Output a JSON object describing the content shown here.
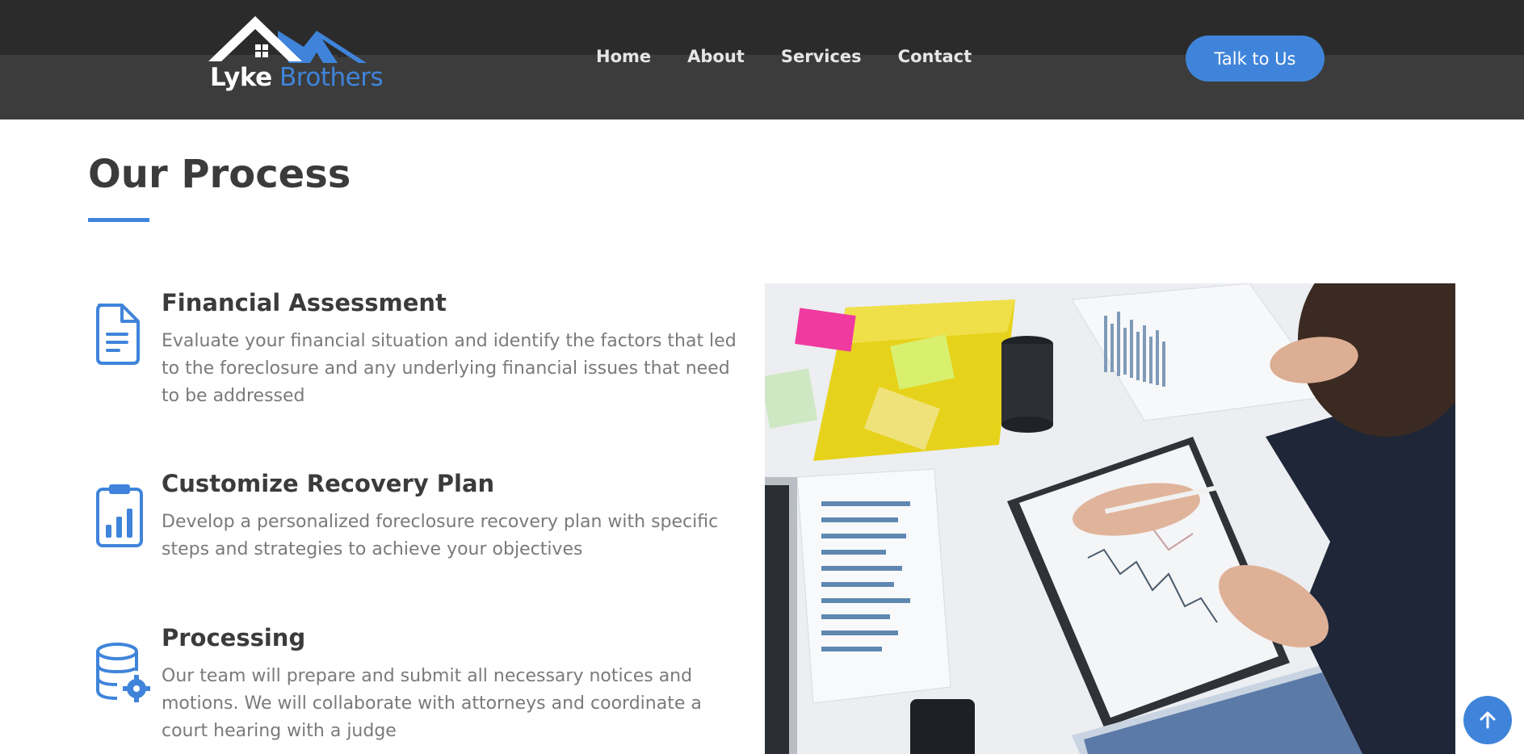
{
  "brand": {
    "name_primary": "Lyke",
    "name_secondary": "Brothers",
    "logo_icon": "house-roof-logo-icon"
  },
  "nav": {
    "items": [
      {
        "label": "Home"
      },
      {
        "label": "About"
      },
      {
        "label": "Services"
      },
      {
        "label": "Contact"
      }
    ],
    "cta_label": "Talk to Us"
  },
  "section": {
    "title": "Our Process",
    "steps": [
      {
        "icon": "document-icon",
        "title": "Financial Assessment",
        "description": "Evaluate your financial situation and identify the factors that led to the foreclosure and any underlying financial issues that need to be addressed"
      },
      {
        "icon": "clipboard-chart-icon",
        "title": "Customize Recovery Plan",
        "description": "Develop a personalized foreclosure recovery plan with specific steps and strategies to achieve your objectives"
      },
      {
        "icon": "database-gear-icon",
        "title": "Processing",
        "description": "Our team will prepare and submit all necessary notices and motions. We will collaborate with attorneys and coordinate a court hearing with a judge"
      }
    ]
  },
  "colors": {
    "accent": "#3f84da",
    "header_dark": "#2b2b2b",
    "header_band": "#3c3c3c",
    "heading_text": "#3b3b3b",
    "body_text": "#7a7a7a"
  },
  "back_to_top_icon": "arrow-up-icon"
}
